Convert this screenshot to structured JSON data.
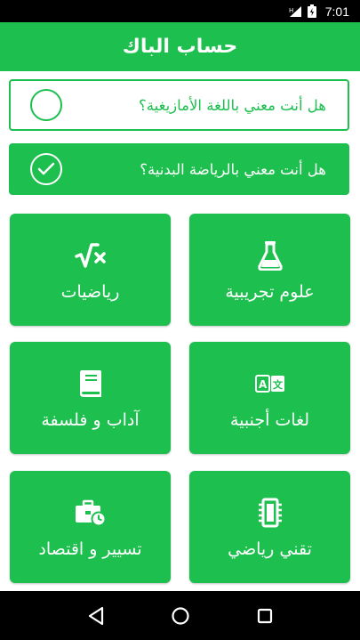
{
  "status_bar": {
    "time": "7:01",
    "icons": [
      "signal-icon",
      "battery-icon"
    ]
  },
  "app_bar": {
    "title": "حساب الباك"
  },
  "options": [
    {
      "label": "هل أنت معني باللغة الأمازيغية؟",
      "checked": false
    },
    {
      "label": "هل أنت معني بالرياضة البدنية؟",
      "checked": true
    }
  ],
  "streams": [
    {
      "label": "رياضيات",
      "icon": "square-root-icon"
    },
    {
      "label": "علوم تجريبية",
      "icon": "flask-icon"
    },
    {
      "label": "آداب و فلسفة",
      "icon": "book-icon"
    },
    {
      "label": "لغات أجنبية",
      "icon": "translate-icon"
    },
    {
      "label": "تسيير و اقتصاد",
      "icon": "briefcase-clock-icon"
    },
    {
      "label": "تقني رياضي",
      "icon": "chip-icon"
    }
  ],
  "colors": {
    "primary": "#1DBF4F",
    "text_on_primary": "#FFFFFF",
    "system_bars": "#000000"
  },
  "nav_bar": {
    "buttons": [
      "back-icon",
      "home-icon",
      "recents-icon"
    ]
  }
}
